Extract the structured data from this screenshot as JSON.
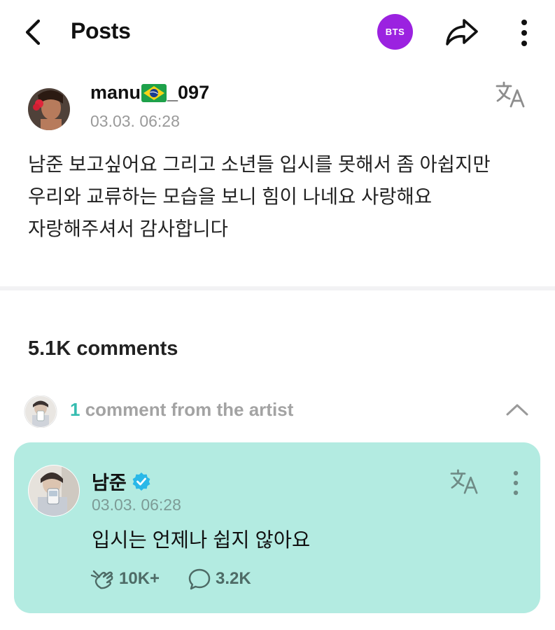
{
  "header": {
    "title": "Posts",
    "badge_label": "BTS",
    "badge_color": "#9b22e0",
    "back_icon": "chevron-left-icon",
    "share_icon": "share-arrow-icon",
    "more_icon": "vertical-dots-icon"
  },
  "post": {
    "username_prefix": "manu",
    "username_suffix": "_097",
    "flag": "brazil-flag",
    "date": "03.03. 06:28",
    "body": "남준 보고싶어요 그리고 소년들 입시를 못해서 좀 아쉽지만 우리와 교류하는 모습을 보니 힘이 나네요 사랑해요 자랑해주셔서 감사합니다",
    "translate_icon": "translate-icon"
  },
  "comments": {
    "count_label": "5.1K comments",
    "artist_count": "1",
    "artist_label": " comment from the artist",
    "collapse_icon": "chevron-up-icon"
  },
  "artist_comment": {
    "name": "남준",
    "verified_icon": "verified-badge-icon",
    "verified_color": "#2ab8e8",
    "date": "03.03. 06:28",
    "text": "입시는 언제나 쉽지 않아요",
    "likes": "10K+",
    "replies": "3.2K",
    "card_color": "#b3ebe1"
  }
}
